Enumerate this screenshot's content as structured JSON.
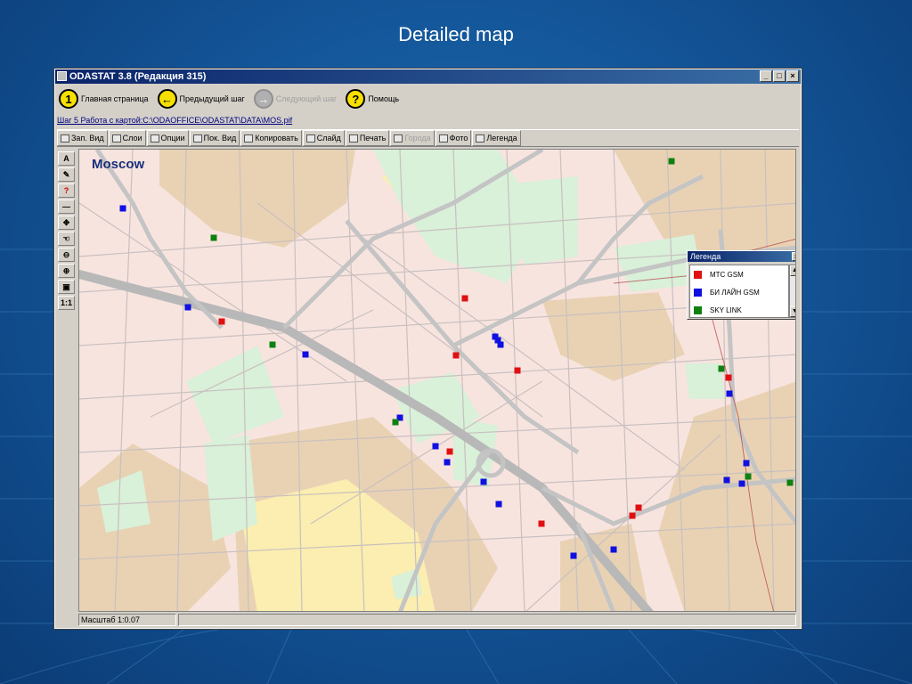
{
  "slide": {
    "title": "Detailed map"
  },
  "window": {
    "title": "ODASTAT 3.8  (Редакция 315)",
    "controls": [
      "_",
      "□",
      "×"
    ]
  },
  "nav": {
    "home": {
      "number": "1",
      "label": "Главная страница"
    },
    "prev": {
      "label": "Предыдущий шаг"
    },
    "next": {
      "label": "Следующий шаг",
      "disabled": true
    },
    "help": {
      "label": "Помощь"
    }
  },
  "path": "Шаг 5 Работа с картой:C:\\ODAOFFICE\\ODASTAT\\DATA\\MOS.pif",
  "toolbar": {
    "items": [
      {
        "label": "Зап. Вид",
        "disabled": false
      },
      {
        "label": "Слои",
        "disabled": false
      },
      {
        "label": "Опции",
        "disabled": false
      },
      {
        "label": "Пок. Вид",
        "disabled": false
      },
      {
        "label": "Копировать",
        "disabled": false
      },
      {
        "label": "Слайд",
        "disabled": false
      },
      {
        "label": "Печать",
        "disabled": false
      },
      {
        "label": "Города",
        "disabled": true
      },
      {
        "label": "Фото",
        "disabled": false
      },
      {
        "label": "Легенда",
        "disabled": false
      }
    ]
  },
  "tools": [
    "A",
    "✎",
    "?",
    "—",
    "✥",
    "☜",
    "⊖",
    "⊕",
    "▣",
    "1:1"
  ],
  "map": {
    "city_label": "Moscow",
    "markers": {
      "red": [
        [
          160,
          193
        ],
        [
          433,
          167
        ],
        [
          423,
          231
        ],
        [
          492,
          248
        ],
        [
          416,
          339
        ],
        [
          519,
          420
        ],
        [
          621,
          411
        ],
        [
          628,
          402
        ],
        [
          729,
          256
        ]
      ],
      "blue": [
        [
          49,
          66
        ],
        [
          122,
          177
        ],
        [
          254,
          230
        ],
        [
          360,
          301
        ],
        [
          400,
          333
        ],
        [
          413,
          351
        ],
        [
          454,
          373
        ],
        [
          471,
          398
        ],
        [
          555,
          456
        ],
        [
          600,
          449
        ],
        [
          467,
          210
        ],
        [
          470,
          214
        ],
        [
          473,
          219
        ],
        [
          730,
          274
        ],
        [
          749,
          352
        ],
        [
          744,
          375
        ],
        [
          727,
          371
        ]
      ],
      "green": [
        [
          151,
          99
        ],
        [
          217,
          219
        ],
        [
          355,
          306
        ],
        [
          665,
          13
        ],
        [
          721,
          246
        ],
        [
          751,
          367
        ],
        [
          798,
          374
        ]
      ]
    }
  },
  "legend": {
    "title": "Легенда",
    "entries": [
      {
        "label": "МТС GSM",
        "color": "#e01010"
      },
      {
        "label": "БИ ЛАЙН GSM",
        "color": "#1010e0"
      },
      {
        "label": "SKY LINK",
        "color": "#108010"
      }
    ]
  },
  "status": {
    "scale": "Масштаб 1:0.07"
  }
}
